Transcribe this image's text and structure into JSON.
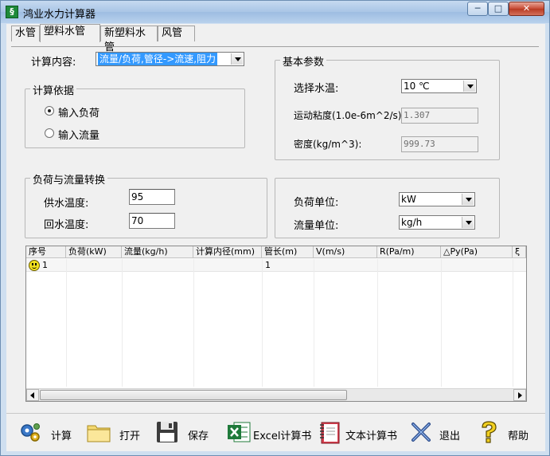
{
  "window": {
    "title": "鸿业水力计算器",
    "min": "─",
    "max": "□",
    "close": "✕",
    "app_icon": "§"
  },
  "tabs": [
    {
      "label": "水管"
    },
    {
      "label": "塑料水管"
    },
    {
      "label": "新塑料水管"
    },
    {
      "label": "风管"
    }
  ],
  "active_tab": 1,
  "calc_content": {
    "label": "计算内容:",
    "value": "流量/负荷,管径->流速,阻力"
  },
  "calc_basis": {
    "title": "计算依据",
    "options": [
      {
        "label": "输入负荷",
        "checked": true
      },
      {
        "label": "输入流量",
        "checked": false
      }
    ]
  },
  "basic_params": {
    "title": "基本参数",
    "water_temp_label": "选择水温:",
    "water_temp_value": "10 ℃",
    "viscosity_label": "运动粘度(1.0e-6m^2/s):",
    "viscosity_value": "1.307",
    "density_label": "密度(kg/m^3):",
    "density_value": "999.73"
  },
  "conversion": {
    "title": "负荷与流量转换",
    "supply_label": "供水温度:",
    "supply_value": "95",
    "return_label": "回水温度:",
    "return_value": "70"
  },
  "units": {
    "load_label": "负荷单位:",
    "load_value": "kW",
    "flow_label": "流量单位:",
    "flow_value": "kg/h"
  },
  "table": {
    "columns": [
      "序号",
      "负荷(kW)",
      "流量(kg/h)",
      "计算内径(mm)",
      "管长(m)",
      "V(m/s)",
      "R(Pa/m)",
      "△Py(Pa)",
      "ξ"
    ],
    "rows": [
      [
        "1",
        "",
        "",
        "",
        "1",
        "",
        "",
        "",
        ""
      ]
    ]
  },
  "toolbar": [
    {
      "label": "计算",
      "icon": "gears-icon"
    },
    {
      "label": "打开",
      "icon": "folder-icon"
    },
    {
      "label": "保存",
      "icon": "floppy-disk-icon"
    },
    {
      "label": "Excel计算书",
      "icon": "excel-icon"
    },
    {
      "label": "文本计算书",
      "icon": "notebook-icon"
    },
    {
      "label": "退出",
      "icon": "exit-x-icon"
    },
    {
      "label": "帮助",
      "icon": "help-question-icon"
    }
  ],
  "colors": {
    "selection": "#3399ff",
    "title_gradient": "#a9c5e6",
    "close_red": "#c74a34"
  }
}
